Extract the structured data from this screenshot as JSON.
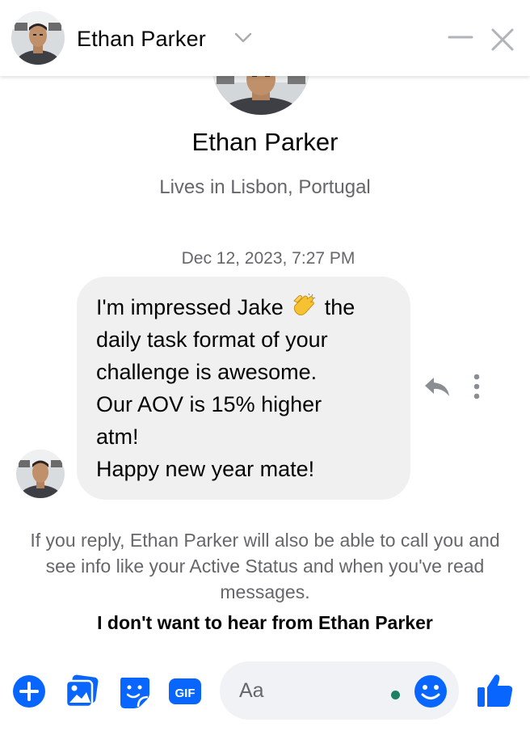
{
  "header": {
    "name": "Ethan Parker"
  },
  "profile": {
    "name": "Ethan Parker",
    "location": "Lives in Lisbon, Portugal"
  },
  "conversation": {
    "timestamp": "Dec 12, 2023, 7:27 PM",
    "message": {
      "line1_before": "I'm impressed Jake",
      "line1_after": "the",
      "line2": "daily task format of your",
      "line3": "challenge is awesome.",
      "line4": "Our AOV is 15% higher",
      "line5": "atm!",
      "line6": "Happy new year mate!",
      "emoji": "clapping-hands"
    }
  },
  "notice": {
    "text": "If you reply, Ethan Parker will also be able to call you and see info like your Active Status and when you've read messages.",
    "block_link": "I don't want to hear from Ethan Parker"
  },
  "composer": {
    "placeholder": "Aa",
    "gif_label": "GIF",
    "tools": [
      "plus-icon",
      "photo-icon",
      "sticker-icon",
      "gif-icon"
    ]
  },
  "colors": {
    "accent": "#0866ff",
    "bubble": "#f0f0f0",
    "secondary_text": "#65676b",
    "online_dot": "#1e7f61"
  }
}
